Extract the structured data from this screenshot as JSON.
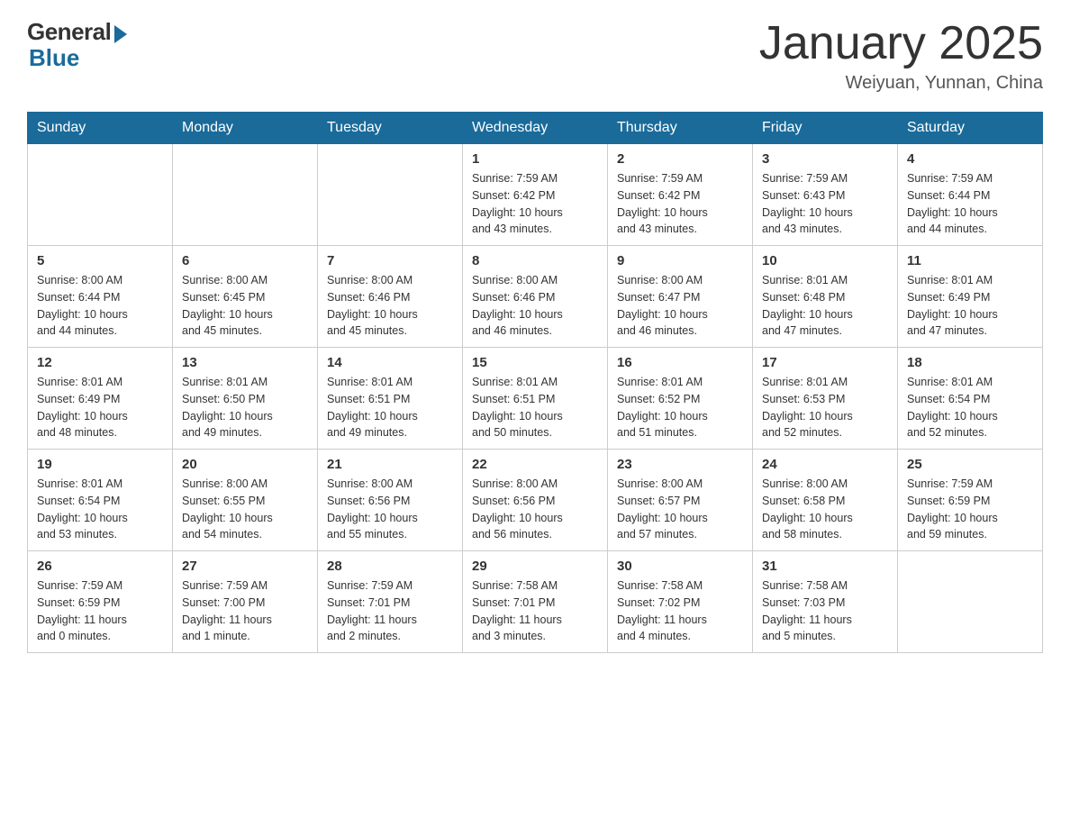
{
  "logo": {
    "general": "General",
    "blue": "Blue"
  },
  "header": {
    "month": "January 2025",
    "location": "Weiyuan, Yunnan, China"
  },
  "days_of_week": [
    "Sunday",
    "Monday",
    "Tuesday",
    "Wednesday",
    "Thursday",
    "Friday",
    "Saturday"
  ],
  "weeks": [
    [
      {
        "day": "",
        "info": ""
      },
      {
        "day": "",
        "info": ""
      },
      {
        "day": "",
        "info": ""
      },
      {
        "day": "1",
        "info": "Sunrise: 7:59 AM\nSunset: 6:42 PM\nDaylight: 10 hours\nand 43 minutes."
      },
      {
        "day": "2",
        "info": "Sunrise: 7:59 AM\nSunset: 6:42 PM\nDaylight: 10 hours\nand 43 minutes."
      },
      {
        "day": "3",
        "info": "Sunrise: 7:59 AM\nSunset: 6:43 PM\nDaylight: 10 hours\nand 43 minutes."
      },
      {
        "day": "4",
        "info": "Sunrise: 7:59 AM\nSunset: 6:44 PM\nDaylight: 10 hours\nand 44 minutes."
      }
    ],
    [
      {
        "day": "5",
        "info": "Sunrise: 8:00 AM\nSunset: 6:44 PM\nDaylight: 10 hours\nand 44 minutes."
      },
      {
        "day": "6",
        "info": "Sunrise: 8:00 AM\nSunset: 6:45 PM\nDaylight: 10 hours\nand 45 minutes."
      },
      {
        "day": "7",
        "info": "Sunrise: 8:00 AM\nSunset: 6:46 PM\nDaylight: 10 hours\nand 45 minutes."
      },
      {
        "day": "8",
        "info": "Sunrise: 8:00 AM\nSunset: 6:46 PM\nDaylight: 10 hours\nand 46 minutes."
      },
      {
        "day": "9",
        "info": "Sunrise: 8:00 AM\nSunset: 6:47 PM\nDaylight: 10 hours\nand 46 minutes."
      },
      {
        "day": "10",
        "info": "Sunrise: 8:01 AM\nSunset: 6:48 PM\nDaylight: 10 hours\nand 47 minutes."
      },
      {
        "day": "11",
        "info": "Sunrise: 8:01 AM\nSunset: 6:49 PM\nDaylight: 10 hours\nand 47 minutes."
      }
    ],
    [
      {
        "day": "12",
        "info": "Sunrise: 8:01 AM\nSunset: 6:49 PM\nDaylight: 10 hours\nand 48 minutes."
      },
      {
        "day": "13",
        "info": "Sunrise: 8:01 AM\nSunset: 6:50 PM\nDaylight: 10 hours\nand 49 minutes."
      },
      {
        "day": "14",
        "info": "Sunrise: 8:01 AM\nSunset: 6:51 PM\nDaylight: 10 hours\nand 49 minutes."
      },
      {
        "day": "15",
        "info": "Sunrise: 8:01 AM\nSunset: 6:51 PM\nDaylight: 10 hours\nand 50 minutes."
      },
      {
        "day": "16",
        "info": "Sunrise: 8:01 AM\nSunset: 6:52 PM\nDaylight: 10 hours\nand 51 minutes."
      },
      {
        "day": "17",
        "info": "Sunrise: 8:01 AM\nSunset: 6:53 PM\nDaylight: 10 hours\nand 52 minutes."
      },
      {
        "day": "18",
        "info": "Sunrise: 8:01 AM\nSunset: 6:54 PM\nDaylight: 10 hours\nand 52 minutes."
      }
    ],
    [
      {
        "day": "19",
        "info": "Sunrise: 8:01 AM\nSunset: 6:54 PM\nDaylight: 10 hours\nand 53 minutes."
      },
      {
        "day": "20",
        "info": "Sunrise: 8:00 AM\nSunset: 6:55 PM\nDaylight: 10 hours\nand 54 minutes."
      },
      {
        "day": "21",
        "info": "Sunrise: 8:00 AM\nSunset: 6:56 PM\nDaylight: 10 hours\nand 55 minutes."
      },
      {
        "day": "22",
        "info": "Sunrise: 8:00 AM\nSunset: 6:56 PM\nDaylight: 10 hours\nand 56 minutes."
      },
      {
        "day": "23",
        "info": "Sunrise: 8:00 AM\nSunset: 6:57 PM\nDaylight: 10 hours\nand 57 minutes."
      },
      {
        "day": "24",
        "info": "Sunrise: 8:00 AM\nSunset: 6:58 PM\nDaylight: 10 hours\nand 58 minutes."
      },
      {
        "day": "25",
        "info": "Sunrise: 7:59 AM\nSunset: 6:59 PM\nDaylight: 10 hours\nand 59 minutes."
      }
    ],
    [
      {
        "day": "26",
        "info": "Sunrise: 7:59 AM\nSunset: 6:59 PM\nDaylight: 11 hours\nand 0 minutes."
      },
      {
        "day": "27",
        "info": "Sunrise: 7:59 AM\nSunset: 7:00 PM\nDaylight: 11 hours\nand 1 minute."
      },
      {
        "day": "28",
        "info": "Sunrise: 7:59 AM\nSunset: 7:01 PM\nDaylight: 11 hours\nand 2 minutes."
      },
      {
        "day": "29",
        "info": "Sunrise: 7:58 AM\nSunset: 7:01 PM\nDaylight: 11 hours\nand 3 minutes."
      },
      {
        "day": "30",
        "info": "Sunrise: 7:58 AM\nSunset: 7:02 PM\nDaylight: 11 hours\nand 4 minutes."
      },
      {
        "day": "31",
        "info": "Sunrise: 7:58 AM\nSunset: 7:03 PM\nDaylight: 11 hours\nand 5 minutes."
      },
      {
        "day": "",
        "info": ""
      }
    ]
  ]
}
